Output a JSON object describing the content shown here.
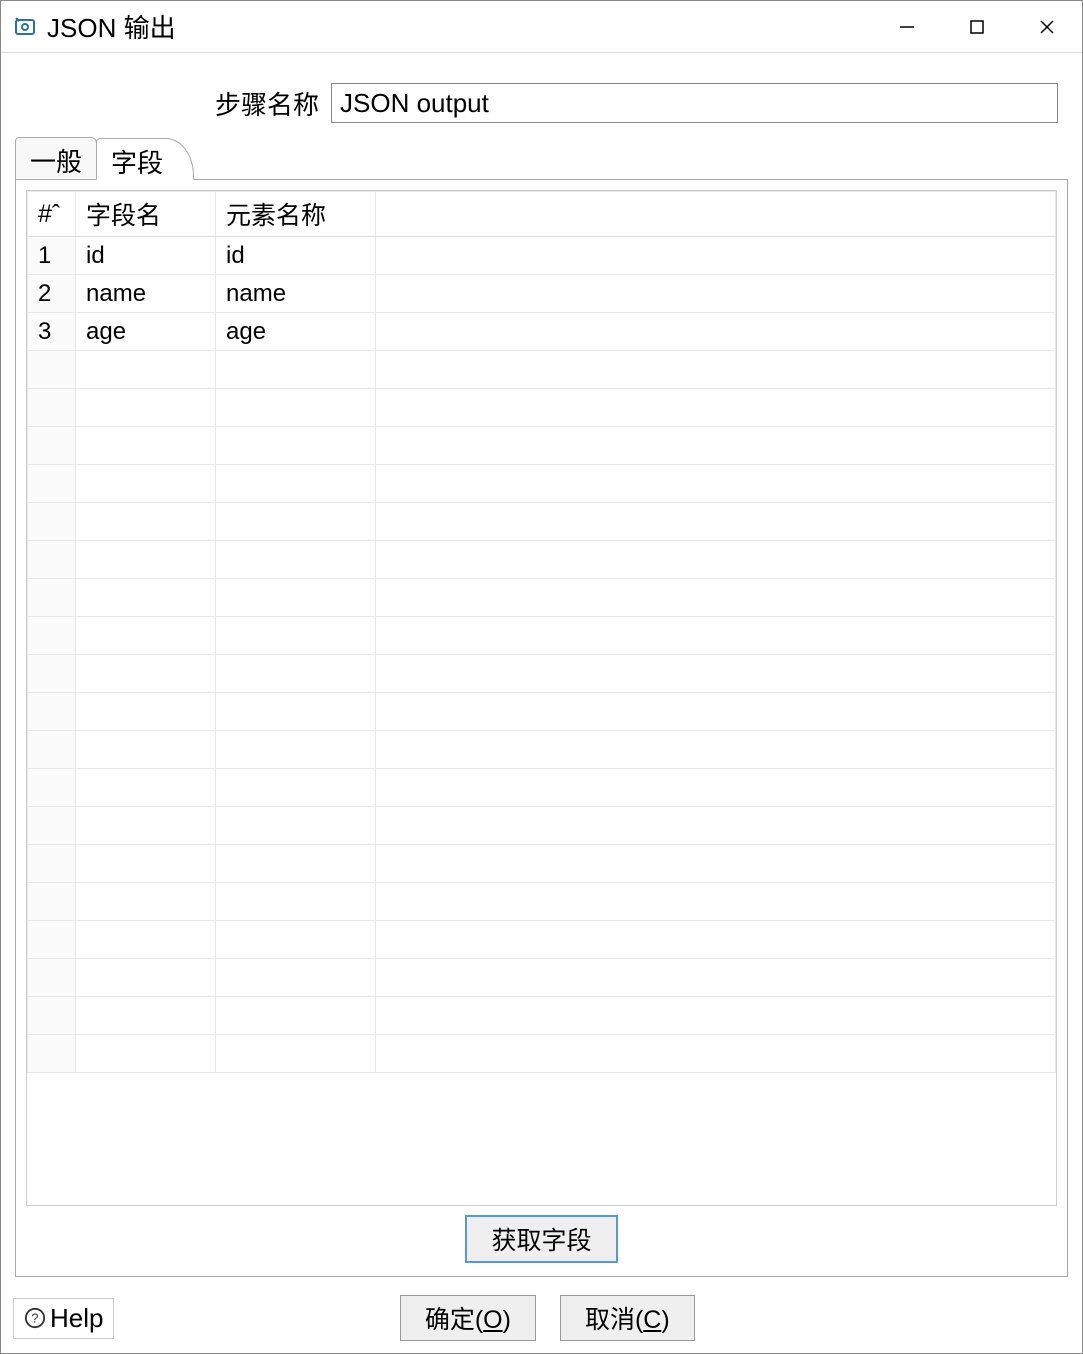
{
  "window": {
    "title": "JSON 输出"
  },
  "form": {
    "step_name_label": "步骤名称",
    "step_name_value": "JSON output"
  },
  "tabs": {
    "general": "一般",
    "fields": "字段"
  },
  "grid": {
    "headers": {
      "num": "#ˆ",
      "field_name": "字段名",
      "element_name": "元素名称"
    },
    "rows": [
      {
        "num": "1",
        "field_name": "id",
        "element_name": "id"
      },
      {
        "num": "2",
        "field_name": "name",
        "element_name": "name"
      },
      {
        "num": "3",
        "field_name": "age",
        "element_name": "age"
      }
    ]
  },
  "buttons": {
    "get_fields": "获取字段",
    "ok_prefix": "确定(",
    "ok_key": "O",
    "ok_suffix": ")",
    "cancel_prefix": "取消(",
    "cancel_key": "C",
    "cancel_suffix": ")"
  },
  "help": {
    "label": "Help"
  }
}
